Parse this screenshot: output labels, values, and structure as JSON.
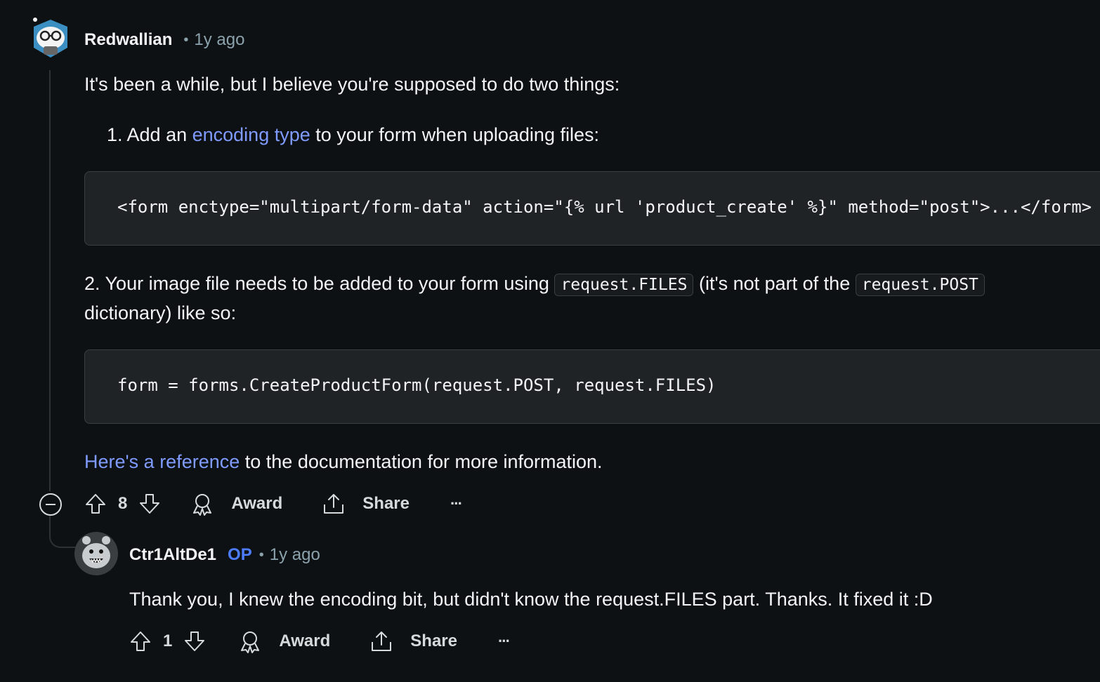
{
  "comment1": {
    "username": "Redwallian",
    "separator": "•",
    "time": "1y ago",
    "intro": "It's been a while, but I believe you're supposed to do two things:",
    "item1_prefix": "1. Add an ",
    "item1_link": "encoding type",
    "item1_suffix": " to your form when uploading files:",
    "code1": "<form enctype=\"multipart/form-data\" action=\"{% url 'product_create' %}\" method=\"post\">...</form>",
    "item2_prefix": "2. Your image file needs to be added to your form using ",
    "item2_code1": "request.FILES",
    "item2_mid": " (it's not part of the ",
    "item2_code2": "request.POST",
    "item2_line2": "dictionary) like so:",
    "code2": "form = forms.CreateProductForm(request.POST, request.FILES)",
    "ref_link": "Here's a reference",
    "ref_suffix": " to the documentation for more information.",
    "votes": "8",
    "award_label": "Award",
    "share_label": "Share",
    "more_label": "···"
  },
  "comment2": {
    "username": "Ctr1AltDe1",
    "op_badge": "OP",
    "separator": "•",
    "time": "1y ago",
    "body": "Thank you, I knew the encoding bit, but didn't know the request.FILES part. Thanks. It fixed it :D",
    "votes": "1",
    "award_label": "Award",
    "share_label": "Share",
    "more_label": "···"
  },
  "icons": [
    "avatar",
    "collapse-icon",
    "upvote-icon",
    "downvote-icon",
    "award-icon",
    "share-icon",
    "more-icon"
  ],
  "colors": {
    "background": "#0e1113",
    "link": "#7f9bff",
    "op": "#4d7cff",
    "meta": "#8ba2ad"
  }
}
